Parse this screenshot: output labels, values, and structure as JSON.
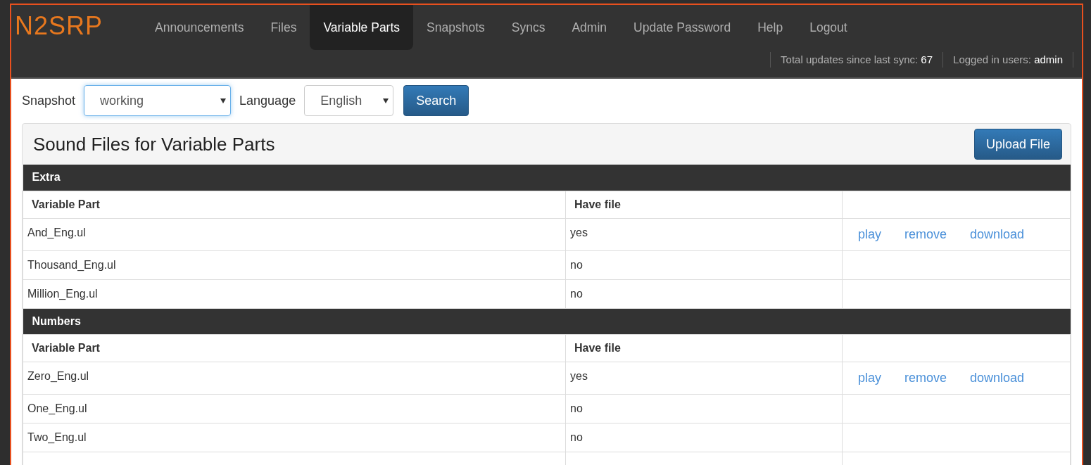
{
  "brand": "N2SRP",
  "nav": [
    {
      "label": "Announcements",
      "selected": false
    },
    {
      "label": "Files",
      "selected": false
    },
    {
      "label": "Variable Parts",
      "selected": true
    },
    {
      "label": "Snapshots",
      "selected": false
    },
    {
      "label": "Syncs",
      "selected": false
    },
    {
      "label": "Admin",
      "selected": false
    },
    {
      "label": "Update Password",
      "selected": false
    },
    {
      "label": "Help",
      "selected": false
    },
    {
      "label": "Logout",
      "selected": false
    }
  ],
  "status": [
    {
      "label": "Total updates since last sync:",
      "value": "67"
    },
    {
      "label": "Logged in users:",
      "value": "admin"
    }
  ],
  "filters": {
    "snapshot_label": "Snapshot",
    "snapshot_value": "working",
    "language_label": "Language",
    "language_value": "English",
    "search_button": "Search"
  },
  "panel": {
    "title": "Sound Files for Variable Parts",
    "upload_button": "Upload File"
  },
  "groups": [
    {
      "name": "Extra",
      "columns": [
        "Variable Part",
        "Have file"
      ],
      "rows": [
        {
          "part": "And_Eng.ul",
          "have_file": "yes",
          "actions": [
            "play",
            "remove",
            "download"
          ]
        },
        {
          "part": "Thousand_Eng.ul",
          "have_file": "no"
        },
        {
          "part": "Million_Eng.ul",
          "have_file": "no"
        }
      ]
    },
    {
      "name": "Numbers",
      "columns": [
        "Variable Part",
        "Have file"
      ],
      "rows": [
        {
          "part": "Zero_Eng.ul",
          "have_file": "yes",
          "actions": [
            "play",
            "remove",
            "download"
          ]
        },
        {
          "part": "One_Eng.ul",
          "have_file": "no"
        },
        {
          "part": "Two_Eng.ul",
          "have_file": "no"
        }
      ]
    }
  ]
}
